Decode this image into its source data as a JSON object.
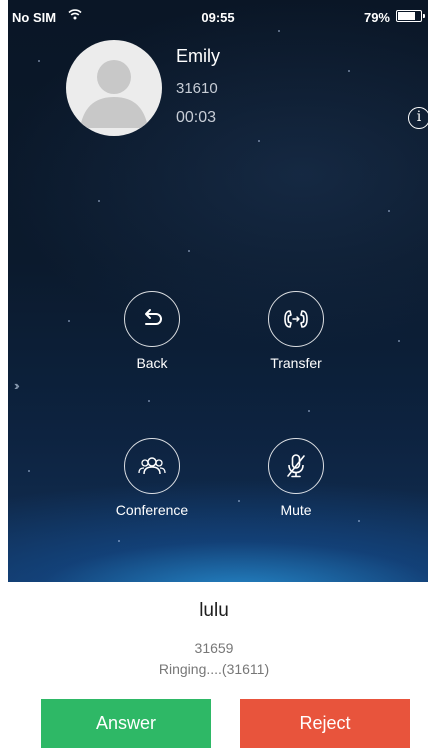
{
  "status_bar": {
    "carrier": "No SIM",
    "time": "09:55",
    "battery": "79%",
    "battery_level": 0.79
  },
  "active_call": {
    "name": "Emily",
    "number": "31610",
    "timer": "00:03",
    "info_icon": "i"
  },
  "actions": {
    "back": "Back",
    "transfer": "Transfer",
    "conference": "Conference",
    "mute": "Mute"
  },
  "incoming_call": {
    "name": "lulu",
    "number": "31659",
    "status": "Ringing....(31611)",
    "answer_label": "Answer",
    "reject_label": "Reject"
  },
  "icons": [
    "wifi-icon",
    "battery-icon",
    "avatar-icon",
    "info-icon",
    "back-icon",
    "transfer-icon",
    "conference-icon",
    "mute-icon",
    "expand-chevron-icon"
  ],
  "colors": {
    "answer": "#2eb866",
    "reject": "#e8543c",
    "background_dark": "#0b1a2d"
  }
}
